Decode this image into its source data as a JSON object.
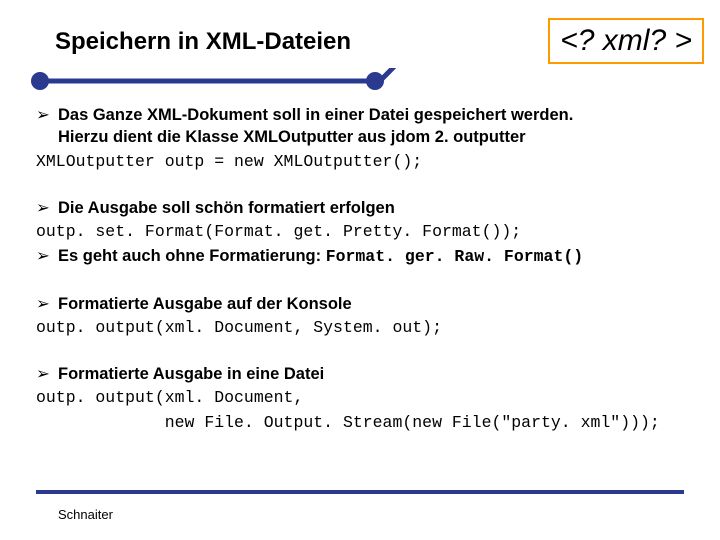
{
  "header": {
    "title": "Speichern in XML-Dateien",
    "badge": "<? xml? >"
  },
  "bullets": {
    "b1_line1": "Das Ganze XML-Dokument soll in einer Datei gespeichert werden.",
    "b1_line2": "Hierzu dient die Klasse XMLOutputter aus jdom 2. outputter",
    "b1_code": "XMLOutputter outp = new XMLOutputter();",
    "b2_line1": "Die Ausgabe soll schön formatiert erfolgen",
    "b2_code": "outp. set. Format(Format. get. Pretty. Format());",
    "b3_text": "Es geht auch ohne Formatierung: ",
    "b3_code": "Format. ger. Raw. Format()",
    "b4_line1": "Formatierte Ausgabe auf der Konsole",
    "b4_code": "outp. output(xml. Document, System. out);",
    "b5_line1": "Formatierte Ausgabe in eine Datei",
    "b5_code1": "outp. output(xml. Document,",
    "b5_code2": "             new File. Output. Stream(new File(\"party. xml\")));"
  },
  "footer": {
    "author": "Schnaiter"
  },
  "colors": {
    "accent": "#2a3a8f",
    "badge_border": "#ff9900"
  }
}
